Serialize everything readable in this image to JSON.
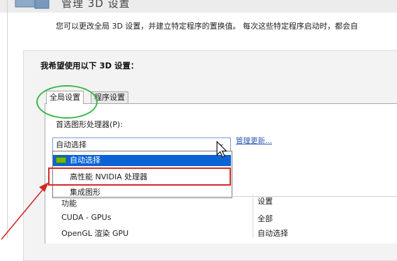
{
  "header": {
    "title": "管理 3D 设置",
    "description": "您可以更改全局 3D 设置，并建立特定程序的置换值。 每次这些特定程序启动时，都会自"
  },
  "section": {
    "heading": "我希望使用以下 3D 设置："
  },
  "tabs": [
    {
      "label": "全局设置",
      "selected": true
    },
    {
      "label": "程序设置",
      "selected": false
    }
  ],
  "processor": {
    "label": "首选图形处理器(P):",
    "selected_value": "自动选择",
    "manage_link": "管理更新...",
    "options": [
      {
        "label": "自动选择",
        "highlighted": true,
        "icon": "nvidia-icon"
      },
      {
        "label": "高性能 NVIDIA 处理器",
        "highlighted": false
      },
      {
        "label": "集成图形",
        "highlighted": false
      }
    ]
  },
  "features_table": {
    "columns": [
      "功能",
      "设置"
    ],
    "rows": [
      {
        "feature": "CUDA - GPUs",
        "setting": "全部"
      },
      {
        "feature": "OpenGL 渲染 GPU",
        "setting": "自动选择"
      }
    ]
  },
  "colors": {
    "highlight": "#0a64d6",
    "annotation_red": "#d02a2a",
    "annotation_green": "#3db84a",
    "nvidia_green": "#76b900",
    "link": "#2a5db0"
  }
}
